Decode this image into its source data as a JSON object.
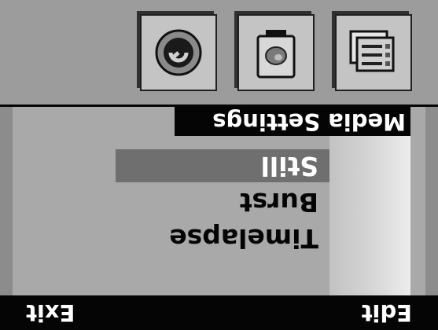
{
  "softkeys": {
    "left": "Edit",
    "right": "Exit"
  },
  "menu": {
    "items": [
      {
        "label": "Timelapse",
        "selected": false
      },
      {
        "label": "Burst",
        "selected": false
      },
      {
        "label": "Still",
        "selected": true
      }
    ]
  },
  "section": {
    "title": "Media Settings"
  },
  "toolbar": {
    "buttons": [
      {
        "icon": "document-list-icon"
      },
      {
        "icon": "camera-icon"
      },
      {
        "icon": "dial-icon"
      }
    ]
  },
  "colors": {
    "bar": "#050505",
    "highlight": "#6f6f6f",
    "background": "#a9a9a9"
  }
}
